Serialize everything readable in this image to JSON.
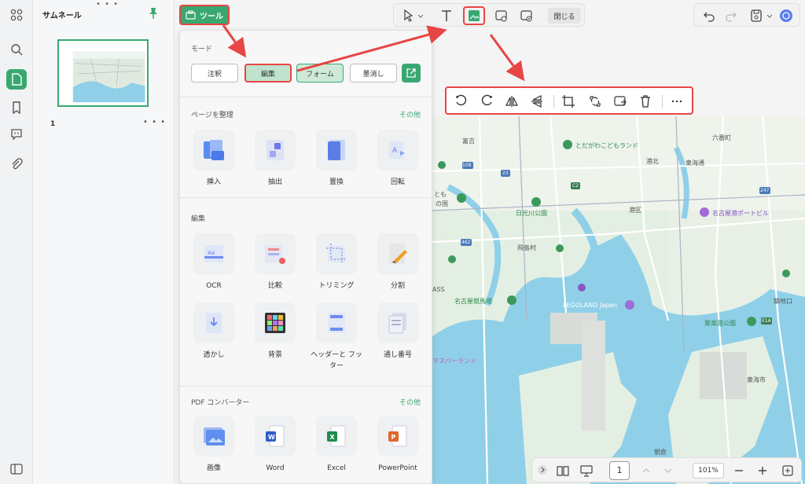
{
  "sidebar": {
    "panel_title": "サムネール",
    "page_number": "1"
  },
  "toolbar": {
    "tools_label": "ツール",
    "close_label": "閉じる"
  },
  "panel": {
    "mode_title": "モード",
    "modes": [
      {
        "label": "注釈"
      },
      {
        "label": "編集"
      },
      {
        "label": "フォーム"
      },
      {
        "label": "墨消し"
      }
    ],
    "organize": {
      "title": "ページを整理",
      "more": "その他",
      "items": [
        {
          "label": "挿入"
        },
        {
          "label": "抽出"
        },
        {
          "label": "置換"
        },
        {
          "label": "回転"
        }
      ]
    },
    "edit": {
      "title": "編集",
      "items": [
        {
          "label": "OCR"
        },
        {
          "label": "比較"
        },
        {
          "label": "トリミング"
        },
        {
          "label": "分割"
        },
        {
          "label": "透かし"
        },
        {
          "label": "背景"
        },
        {
          "label": "ヘッダーと フッター"
        },
        {
          "label": "通し番号"
        }
      ]
    },
    "converter": {
      "title": "PDF コンバーター",
      "more": "その他",
      "items": [
        {
          "label": "画像"
        },
        {
          "label": "Word"
        },
        {
          "label": "Excel"
        },
        {
          "label": "PowerPoint"
        }
      ]
    }
  },
  "map": {
    "labels": [
      "富吉",
      "とだがわこどもランド",
      "六番町",
      "港北",
      "東海通",
      "日光川公園",
      "港区",
      "名古屋港ポートビル",
      "飛島村",
      "名古屋競馬場",
      "LEGOLAND Japan",
      "築地口",
      "聚楽園公園",
      "東海市",
      "マスパーランド",
      "朝倉",
      "とも",
      "の国",
      "ASS"
    ],
    "roads": [
      "109",
      "23",
      "462",
      "C2",
      "247",
      "E1A"
    ]
  },
  "bottom": {
    "page": "1",
    "zoom": "101%"
  },
  "colors": {
    "accent": "#39a870",
    "highlight": "#e84545",
    "water": "#8fd0e8"
  }
}
